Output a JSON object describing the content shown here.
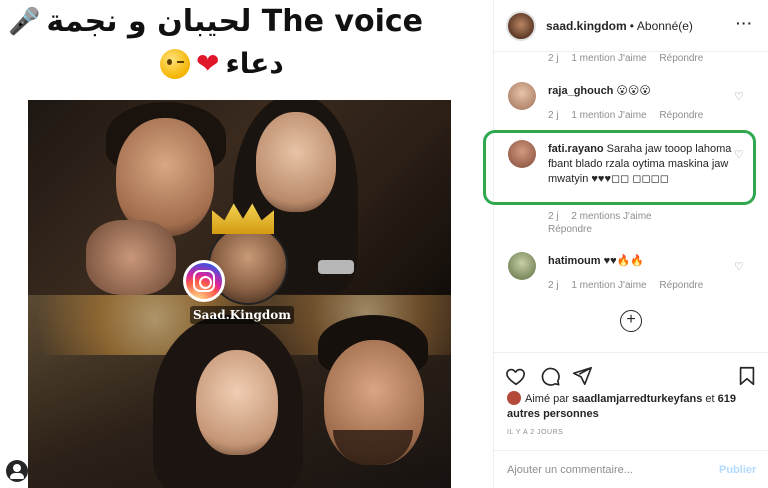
{
  "post": {
    "caption_line1": "لحيبان و نجمة The voice",
    "caption_line2": "دعاء",
    "watermark": "Saad.Kingdom"
  },
  "header": {
    "username": "saad.kingdom",
    "separator": "•",
    "follow_status": "Abonné(e)",
    "more": "···"
  },
  "partial_meta": {
    "time": "2 j",
    "likes": "1 mention J'aime",
    "reply": "Répondre"
  },
  "comments": [
    {
      "username": "raja_ghouch",
      "text": "😮😮😮",
      "time": "2 j",
      "likes": "1 mention J'aime",
      "reply": "Répondre",
      "avatar_color": "#c99a7a"
    },
    {
      "username": "fati.rayano",
      "text": "Saraha jaw tooop lahoma fbant blado rzala oytima maskina jaw mwatyin ♥♥♥◻◻ ◻◻◻◻",
      "time": "2 j",
      "likes": "2 mentions J'aime",
      "reply": "Répondre",
      "avatar_color": "#a0604a",
      "highlighted": true
    },
    {
      "username": "hatimoum",
      "text": "♥♥🔥🔥",
      "time": "2 j",
      "likes": "1 mention J'aime",
      "reply": "Répondre",
      "avatar_color": "#7a8a5a"
    }
  ],
  "load_more": "+",
  "likes": {
    "prefix": "Aimé par",
    "user": "saadlamjarredturkeyfans",
    "conj": "et",
    "others": "619 autres personnes"
  },
  "timestamp": "IL Y A 2 JOURS",
  "comment_box": {
    "placeholder": "Ajouter un commentaire...",
    "publish": "Publier"
  },
  "icons": {
    "like": "heart-outline-icon",
    "comment": "comment-icon",
    "share": "share-icon",
    "save": "bookmark-icon"
  },
  "colors": {
    "highlight": "#2fa84f",
    "publish": "#b3dbff",
    "muted": "#8e8e8e"
  }
}
